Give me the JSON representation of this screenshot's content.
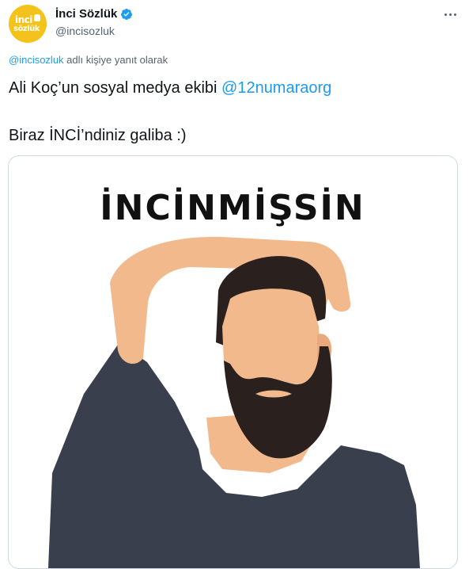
{
  "account": {
    "name": "İnci Sözlük",
    "handle": "@incisozluk",
    "avatar_text_top": "inci",
    "avatar_text_bottom": "sözlük",
    "avatar_color": "#f3c21b",
    "verified_icon": "verified-badge-icon"
  },
  "reply_context": {
    "handle": "@incisozluk",
    "text": " adlı kişiye yanıt olarak"
  },
  "tweet": {
    "line1_text": "Ali Koç’un sosyal medya ekibi ",
    "line1_mention": "@12numaraorg",
    "line2_text": "Biraz İNCİ’ndiniz galiba :)"
  },
  "media": {
    "caption": "İNCİNMİŞSİN"
  },
  "colors": {
    "link": "#1d9bf0",
    "text": "#0f1419",
    "secondary": "#536471",
    "border": "#cfd9de",
    "skin": "#f2b98d",
    "beard": "#2a211f",
    "shirt": "#3a3f4d"
  },
  "icons": {
    "more": "more-options-icon"
  }
}
